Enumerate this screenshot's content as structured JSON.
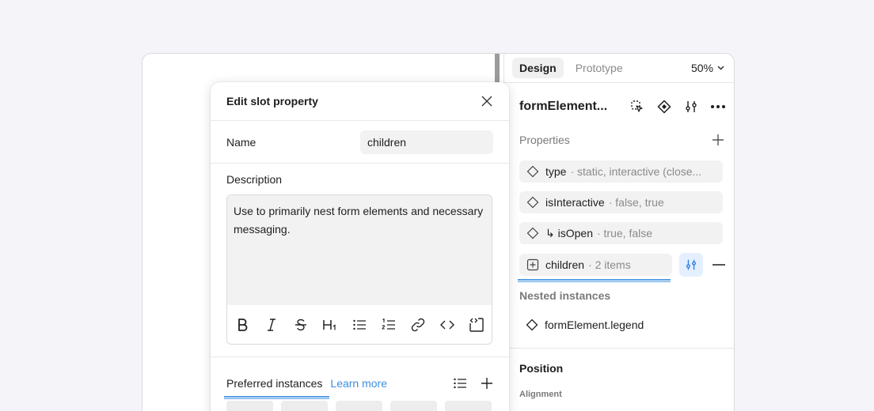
{
  "panel": {
    "tabs": {
      "design": "Design",
      "prototype": "Prototype"
    },
    "zoom": "50%",
    "component_name": "formElement...",
    "properties_title": "Properties",
    "properties": [
      {
        "name": "type",
        "value": "static, interactive (close..."
      },
      {
        "name": "isInteractive",
        "value": "false, true"
      },
      {
        "name": "↳ isOpen",
        "value": "true, false"
      }
    ],
    "slot": {
      "name": "children",
      "value": "2 items"
    },
    "nested_title": "Nested instances",
    "nested": [
      {
        "name": "formElement.legend"
      }
    ],
    "position_title": "Position",
    "alignment_title": "Alignment"
  },
  "modal": {
    "title": "Edit slot property",
    "name_label": "Name",
    "name_value": "children",
    "description_label": "Description",
    "description_text": "Use to primarily nest form elements and necessary messaging.",
    "toolbar": [
      "B",
      "I",
      "S",
      "H₁",
      "bulleted-list",
      "numbered-list",
      "link",
      "code",
      "code-block"
    ],
    "preferred_label": "Preferred instances",
    "learn_more": "Learn more"
  },
  "colors": {
    "accent": "#3b8fe0",
    "slot_button_bg": "#e4efff",
    "background": "#f4f4f9"
  }
}
